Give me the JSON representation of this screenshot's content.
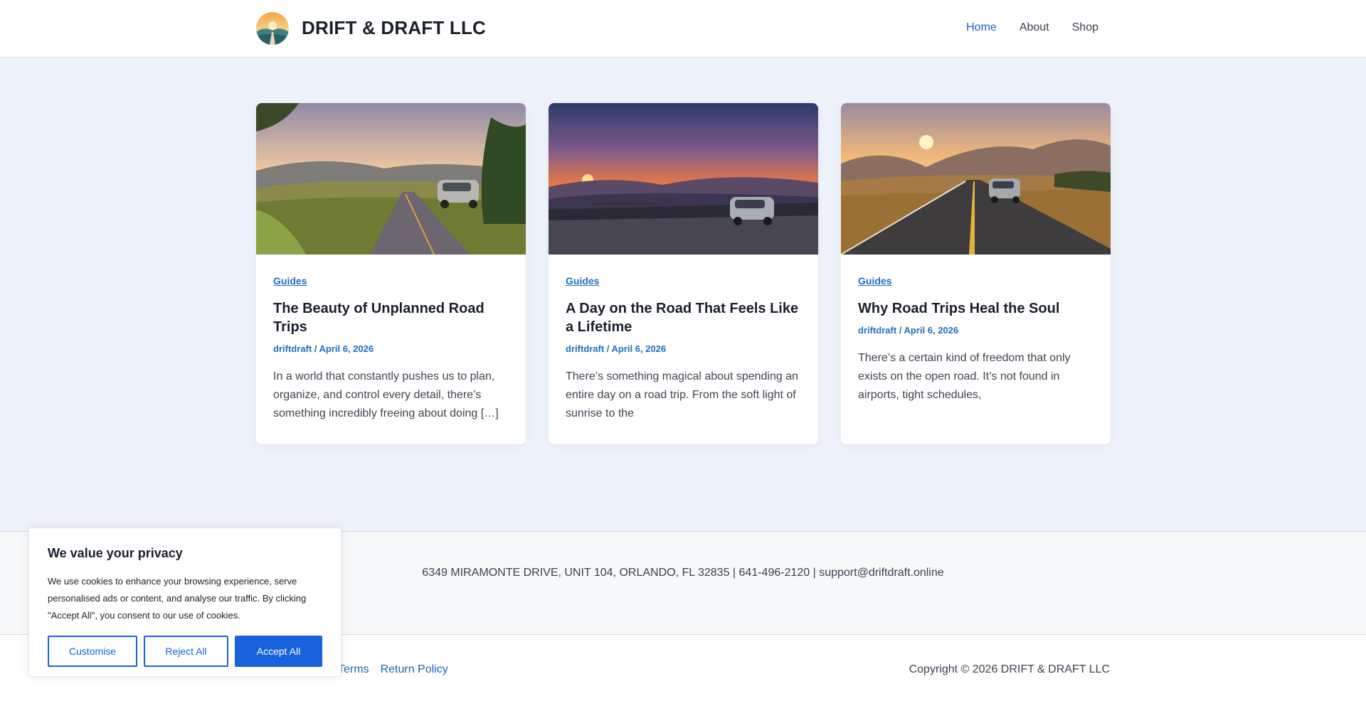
{
  "header": {
    "site_title": "DRIFT & DRAFT LLC",
    "nav": [
      {
        "label": "Home",
        "active": true
      },
      {
        "label": "About",
        "active": false
      },
      {
        "label": "Shop",
        "active": false
      }
    ]
  },
  "posts": [
    {
      "category": "Guides",
      "title": "The Beauty of Unplanned Road Trips",
      "meta": "driftdraft / April 6, 2026",
      "excerpt": "In a world that constantly pushes us to plan, organize, and control every detail, there’s something incredibly freeing about doing […]",
      "image": "country-road-sunset-photo"
    },
    {
      "category": "Guides",
      "title": "A Day on the Road That Feels Like a Lifetime",
      "meta": "driftdraft / April 6, 2026",
      "excerpt": "There’s something magical about spending an entire day on a road trip. From the soft light of sunrise to the",
      "image": "mountain-overlook-sunset-photo"
    },
    {
      "category": "Guides",
      "title": "Why Road Trips Heal the Soul",
      "meta": "driftdraft / April 6, 2026",
      "excerpt": "There’s a certain kind of freedom that only exists on the open road. It’s not found in airports, tight schedules,",
      "image": "open-highway-sunset-photo"
    }
  ],
  "footer": {
    "address": "6349 MIRAMONTE DRIVE, UNIT 104, ORLANDO, FL 32835 | 641-496-2120 | support@driftdraft.online",
    "links": [
      "Terms",
      "Return Policy"
    ],
    "copyright": "Copyright © 2026 DRIFT & DRAFT LLC"
  },
  "cookie_banner": {
    "title": "We value your privacy",
    "text": "We use cookies to enhance your browsing experience, serve personalised ads or content, and analyse our traffic. By clicking \"Accept All\", you consent to our use of cookies.",
    "customise_label": "Customise",
    "reject_label": "Reject All",
    "accept_label": "Accept All"
  },
  "colors": {
    "accent": "#1863dc",
    "link": "#1f63b5",
    "page_bg": "#eef3fb"
  }
}
